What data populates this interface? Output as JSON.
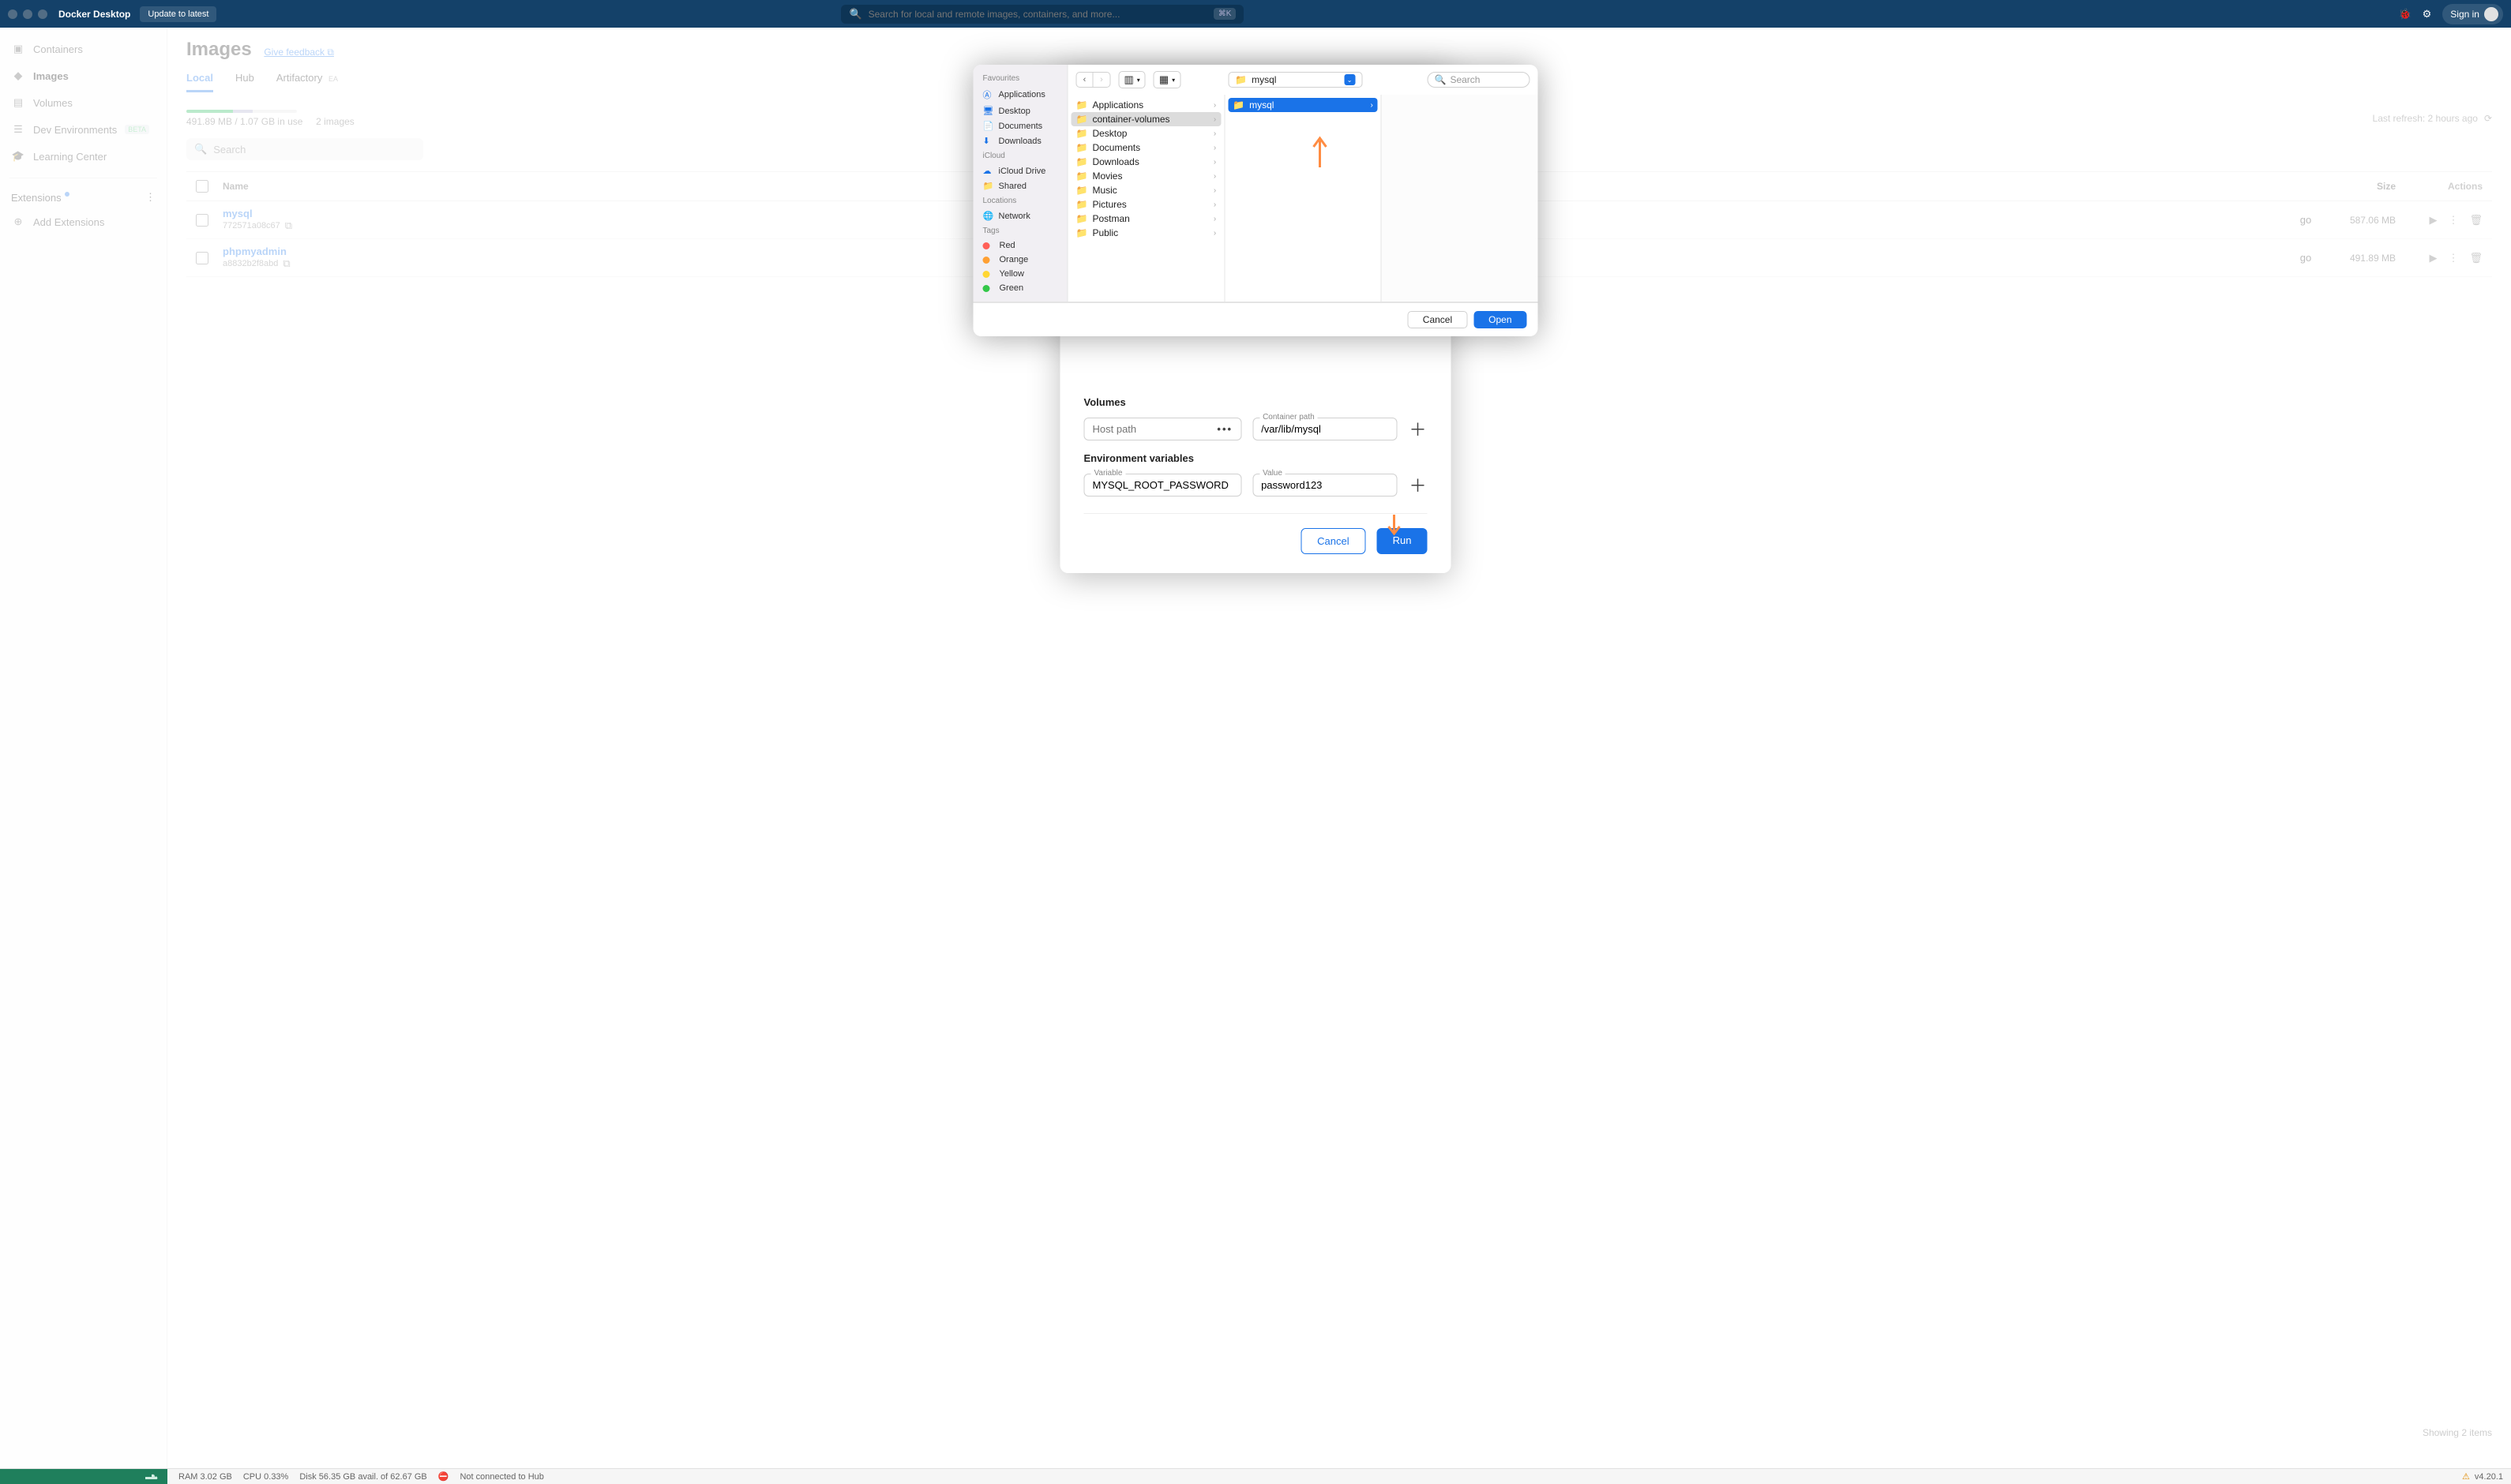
{
  "titlebar": {
    "app_name": "Docker Desktop",
    "update_label": "Update to latest",
    "search_placeholder": "Search for local and remote images, containers, and more...",
    "shortcut": "⌘K",
    "sign_in": "Sign in"
  },
  "sidebar": {
    "items": [
      {
        "label": "Containers"
      },
      {
        "label": "Images"
      },
      {
        "label": "Volumes"
      },
      {
        "label": "Dev Environments",
        "beta": "BETA"
      },
      {
        "label": "Learning Center"
      }
    ],
    "extensions": "Extensions",
    "add_ext": "Add Extensions"
  },
  "main": {
    "title": "Images",
    "feedback": "Give feedback",
    "tabs": [
      {
        "label": "Local"
      },
      {
        "label": "Hub"
      },
      {
        "label": "Artifactory",
        "ea": "EA"
      }
    ],
    "usage_text": "491.89 MB / 1.07 GB in use",
    "image_count": "2 images",
    "last_refresh": "Last refresh: 2 hours ago",
    "search_placeholder": "Search",
    "columns": {
      "name": "Name",
      "size": "Size",
      "actions": "Actions"
    },
    "rows": [
      {
        "name": "mysql",
        "hash": "772571a08c67",
        "created_suffix": "go",
        "size": "587.06 MB"
      },
      {
        "name": "phpmyadmin",
        "hash": "a8832b2f8abd",
        "created_suffix": "go",
        "size": "491.89 MB"
      }
    ],
    "showing": "Showing 2 items"
  },
  "docker_modal": {
    "volumes_title": "Volumes",
    "host_path_placeholder": "Host path",
    "container_path_label": "Container path",
    "container_path_value": "/var/lib/mysql",
    "env_title": "Environment variables",
    "var_label": "Variable",
    "var_value": "MYSQL_ROOT_PASSWORD",
    "val_label": "Value",
    "val_value": "password123",
    "cancel": "Cancel",
    "run": "Run"
  },
  "finder": {
    "favourites_label": "Favourites",
    "icloud_label": "iCloud",
    "locations_label": "Locations",
    "tags_label": "Tags",
    "favourites": [
      "Applications",
      "Desktop",
      "Documents",
      "Downloads"
    ],
    "icloud": [
      "iCloud Drive",
      "Shared"
    ],
    "locations": [
      "Network"
    ],
    "tags": [
      {
        "label": "Red",
        "color": "#ff5f57"
      },
      {
        "label": "Orange",
        "color": "#ffa033"
      },
      {
        "label": "Yellow",
        "color": "#ffd633"
      },
      {
        "label": "Green",
        "color": "#34c749"
      }
    ],
    "path": "mysql",
    "search_placeholder": "Search",
    "col1": [
      "Applications",
      "container-volumes",
      "Desktop",
      "Documents",
      "Downloads",
      "Movies",
      "Music",
      "Pictures",
      "Postman",
      "Public"
    ],
    "col1_selected": "container-volumes",
    "col2": [
      "mysql"
    ],
    "col2_selected": "mysql",
    "cancel": "Cancel",
    "open": "Open"
  },
  "statusbar": {
    "ram": "RAM 3.02 GB",
    "cpu": "CPU 0.33%",
    "disk": "Disk 56.35 GB avail. of 62.67 GB",
    "hub": "Not connected to Hub",
    "version": "v4.20.1"
  }
}
